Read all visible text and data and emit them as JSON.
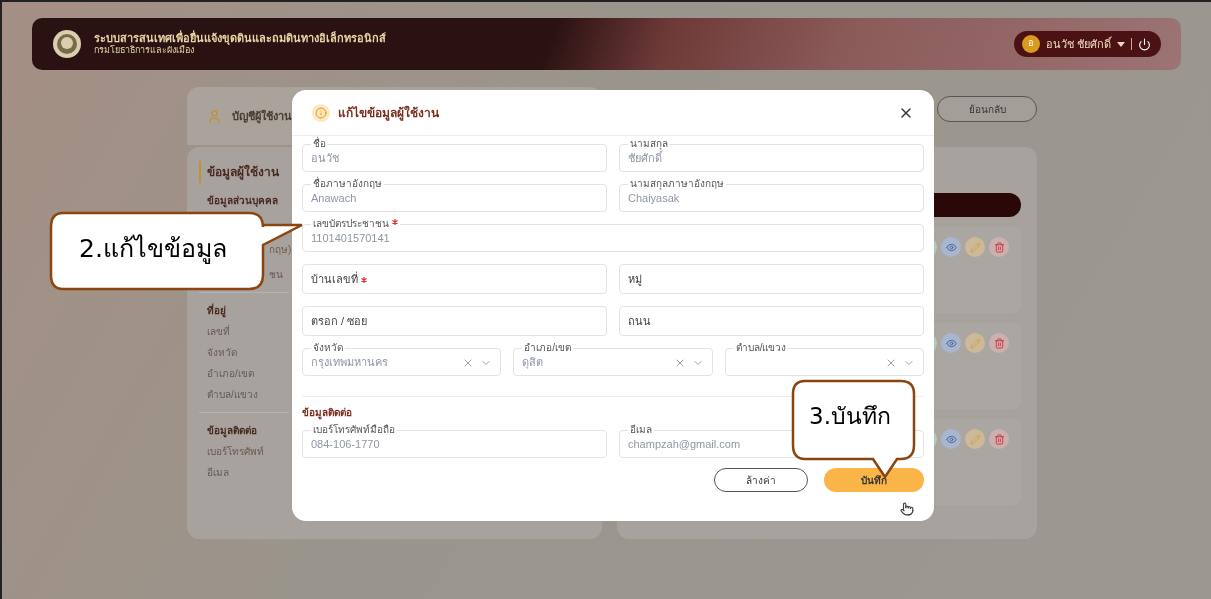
{
  "header": {
    "title": "ระบบสารสนเทศเพื่อยื่นแจ้งขุดดินและถมดินทางอิเล็กทรอนิกส์",
    "subtitle": "กรมโยธาธิการและผังเมือง",
    "user": {
      "initial": "อ",
      "name": "อนวัช ชัยศักดิ์"
    }
  },
  "page": {
    "account_title": "บัญชีผู้ใช้งาน",
    "back_button": "ย้อนกลับ",
    "sidebar": {
      "heading": "ข้อมูลผู้ใช้งาน",
      "sections": [
        {
          "title": "ข้อมูลส่วนบุคคล",
          "items": [
            "กฤษ)",
            "ชน"
          ]
        },
        {
          "title": "ที่อยู่",
          "items": [
            "เลขที่",
            "จังหวัด",
            "อำเภอ/เขต",
            "ตำบล/แขวง"
          ]
        },
        {
          "title": "ข้อมูลติดต่อ",
          "items": [
            "เบอร์โทรศัพท์",
            "อีเมล"
          ]
        }
      ]
    },
    "record_rows": [
      {
        "actions": [
          {
            "kind": "user"
          },
          {
            "kind": "view"
          },
          {
            "kind": "edit"
          },
          {
            "kind": "delete"
          }
        ]
      },
      {
        "actions": [
          {
            "kind": "user"
          },
          {
            "kind": "view"
          },
          {
            "kind": "edit"
          },
          {
            "kind": "delete"
          }
        ]
      },
      {
        "actions": [
          {
            "kind": "user"
          },
          {
            "kind": "view"
          },
          {
            "kind": "edit"
          },
          {
            "kind": "delete"
          }
        ]
      }
    ]
  },
  "modal": {
    "title": "แก้ไขข้อมูลผู้ใช้งาน",
    "rows": [
      {
        "fields": [
          {
            "kind": "floating",
            "label": "ชื่อ",
            "value": "อนวัช",
            "required": false
          },
          {
            "kind": "floating",
            "label": "นามสกุล",
            "value": "ชัยศักดิ์",
            "required": false
          }
        ]
      },
      {
        "fields": [
          {
            "kind": "floating",
            "label": "ชื่อภาษาอังกฤษ",
            "value": "Anawach",
            "required": false
          },
          {
            "kind": "floating",
            "label": "นามสกุลภาษาอังกฤษ",
            "value": "Chaiyasak",
            "required": false
          }
        ]
      },
      {
        "fields": [
          {
            "kind": "floating",
            "label": "เลขบัตรประชาชน",
            "value": "1101401570141",
            "required": true
          }
        ]
      },
      {
        "fields": [
          {
            "kind": "empty",
            "label": "บ้านเลขที่",
            "required": true
          },
          {
            "kind": "empty",
            "label": "หมู่",
            "required": false
          }
        ]
      },
      {
        "fields": [
          {
            "kind": "empty",
            "label": "ตรอก / ซอย",
            "required": false
          },
          {
            "kind": "empty",
            "label": "ถนน",
            "required": false
          }
        ]
      },
      {
        "fields": [
          {
            "kind": "select",
            "label": "จังหวัด",
            "value": "กรุงเทพมหานคร",
            "required": false
          },
          {
            "kind": "select",
            "label": "อำเภอ/เขต",
            "value": "ดุสิต",
            "required": false
          },
          {
            "kind": "select",
            "label": "ตำบล/แขวง",
            "required": false
          }
        ]
      }
    ],
    "contact_heading": "ข้อมูลติดต่อ",
    "contact_rows": [
      {
        "fields": [
          {
            "kind": "floating",
            "label": "เบอร์โทรศัพท์มือถือ",
            "value": "084-106-1770",
            "required": false
          },
          {
            "kind": "floating",
            "label": "อีเมล",
            "value": "champzah@gmail.com",
            "required": false
          }
        ]
      }
    ],
    "reset_button": "ล้างค่า",
    "save_button": "บันทึก"
  },
  "callouts": [
    {
      "kind": "left",
      "text": "2.แก้ไขข้อมูล"
    },
    {
      "kind": "down",
      "text": "3.บันทึก"
    }
  ]
}
